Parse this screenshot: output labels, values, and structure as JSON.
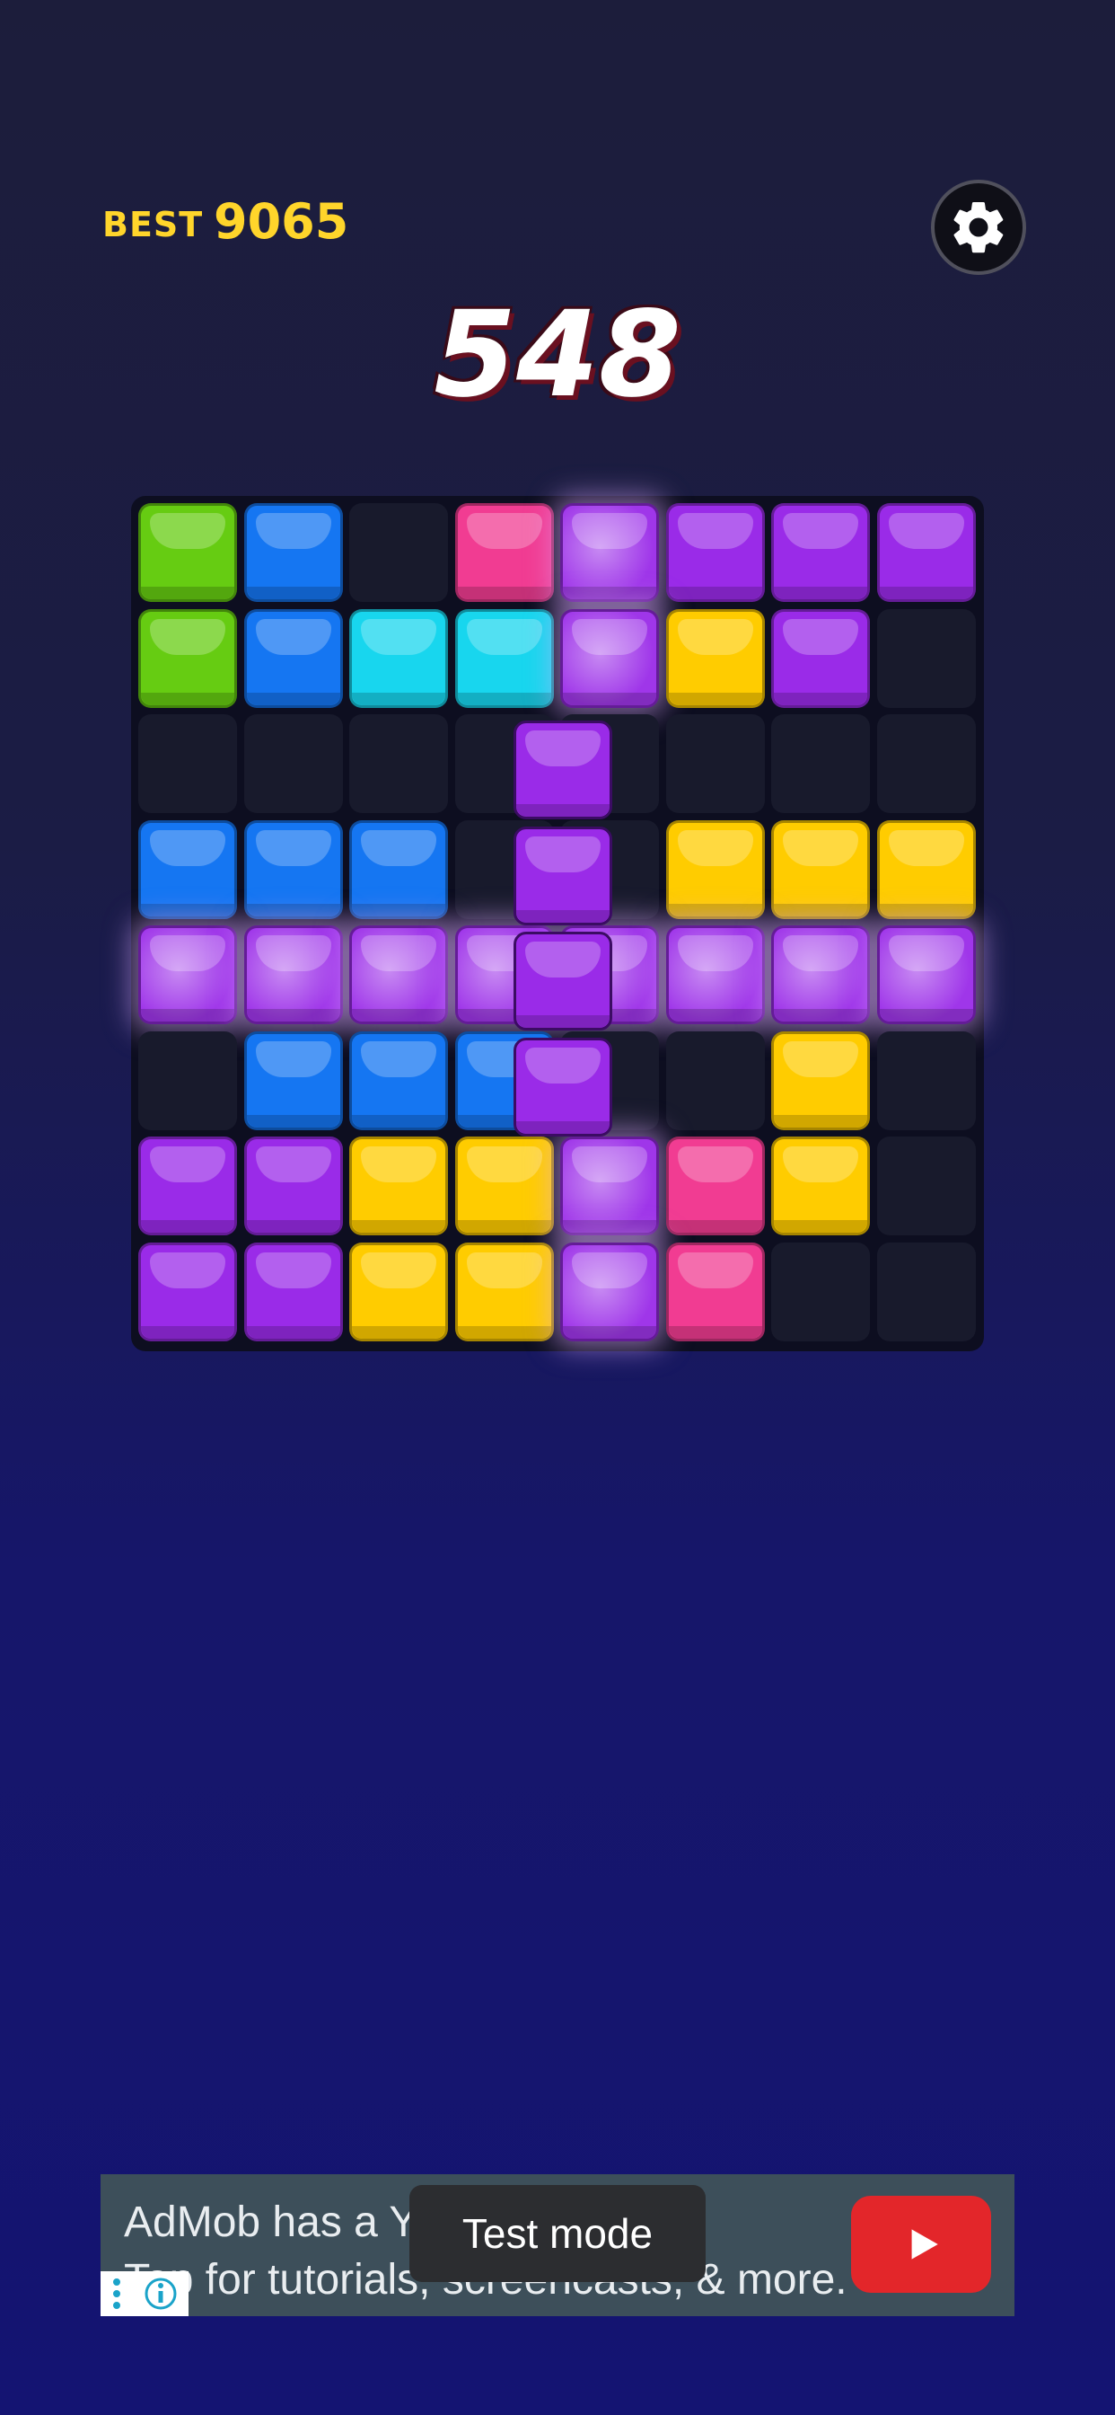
{
  "header": {
    "best_label": "BEST",
    "best_value": "9065",
    "score": "548",
    "settings_icon": "gear-icon"
  },
  "colors": {
    "green": "#66cc12",
    "blue": "#1576f2",
    "cyan": "#18d6ee",
    "pink": "#f13c92",
    "purple": "#9a2be8",
    "yellow": "#ffcc00"
  },
  "board": {
    "rows": 8,
    "cols": 8,
    "cells": [
      [
        "green",
        "blue",
        "empty",
        "pink",
        "purple*",
        "purple",
        "purple",
        "purple"
      ],
      [
        "green",
        "blue",
        "cyan",
        "cyan",
        "purple*",
        "yellow",
        "purple",
        "empty"
      ],
      [
        "empty",
        "empty",
        "empty",
        "empty",
        "empty",
        "empty",
        "empty",
        "empty"
      ],
      [
        "blue",
        "blue",
        "blue",
        "empty",
        "empty",
        "yellow",
        "yellow",
        "yellow"
      ],
      [
        "purple*",
        "purple*",
        "purple*",
        "purple*",
        "purple*",
        "purple*",
        "purple*",
        "purple*"
      ],
      [
        "empty",
        "blue",
        "blue",
        "blue",
        "empty",
        "empty",
        "yellow",
        "empty"
      ],
      [
        "purple",
        "purple",
        "yellow",
        "yellow",
        "purple*",
        "pink",
        "yellow",
        "empty"
      ],
      [
        "purple",
        "purple",
        "yellow",
        "yellow",
        "purple*",
        "pink",
        "empty",
        "empty"
      ]
    ]
  },
  "dragged_piece": {
    "color": "purple",
    "shape": "vertical-4"
  },
  "ad": {
    "line1": "AdMob has a Yo",
    "line2": "Tap for tutorials, screencasts, & more.",
    "toast": "Test mode"
  }
}
